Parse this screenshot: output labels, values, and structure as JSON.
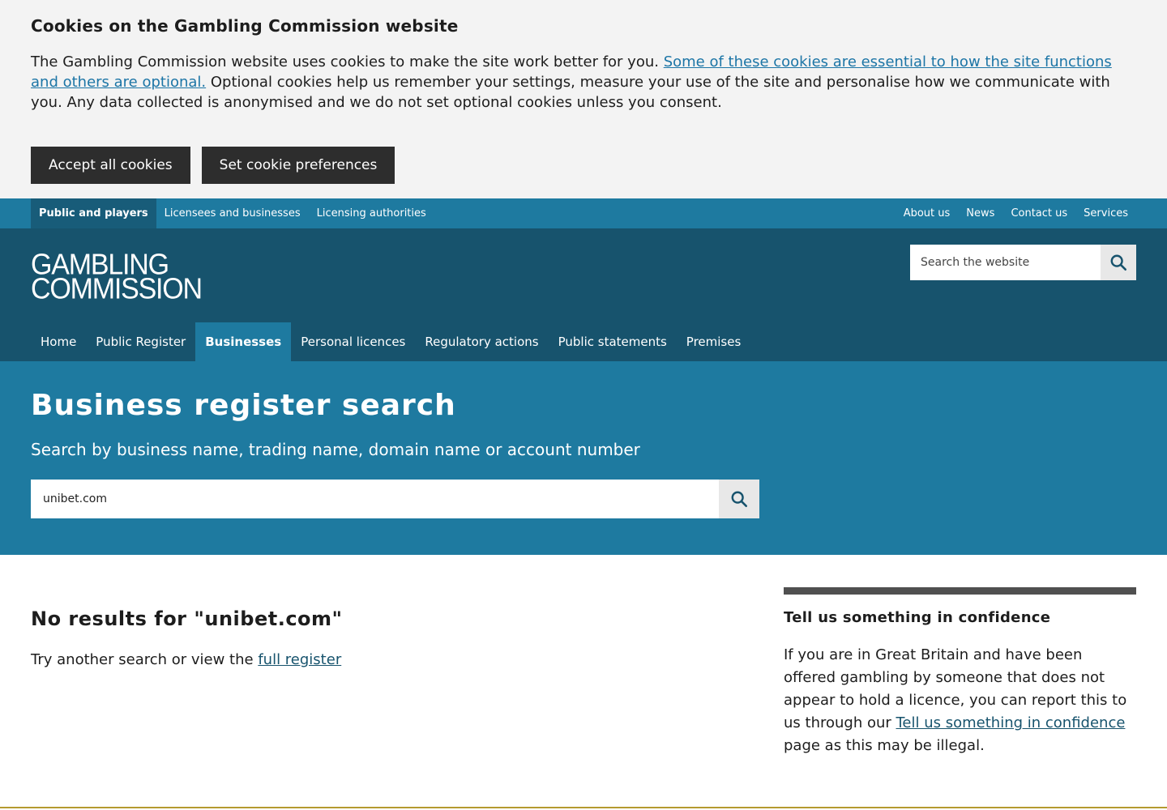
{
  "cookie": {
    "title": "Cookies on the Gambling Commission website",
    "text_before": "The Gambling Commission website uses cookies to make the site work better for you. ",
    "link_text": "Some of these cookies are essential to how the site functions and others are optional.",
    "text_after": " Optional cookies help us remember your settings, measure your use of the site and personalise how we communicate with you. Any data collected is anonymised and we do not set optional cookies unless you consent.",
    "accept_label": "Accept all cookies",
    "prefs_label": "Set cookie preferences"
  },
  "topbar": {
    "audiences": [
      {
        "label": "Public and players",
        "active": true
      },
      {
        "label": "Licensees and businesses",
        "active": false
      },
      {
        "label": "Licensing authorities",
        "active": false
      }
    ],
    "links": [
      "About us",
      "News",
      "Contact us",
      "Services"
    ]
  },
  "header": {
    "logo_line1": "GAMBLING",
    "logo_line2": "COMMISSION",
    "search_placeholder": "Search the website",
    "nav": [
      {
        "label": "Home",
        "active": false
      },
      {
        "label": "Public Register",
        "active": false
      },
      {
        "label": "Businesses",
        "active": true
      },
      {
        "label": "Personal licences",
        "active": false
      },
      {
        "label": "Regulatory actions",
        "active": false
      },
      {
        "label": "Public statements",
        "active": false
      },
      {
        "label": "Premises",
        "active": false
      }
    ]
  },
  "hero": {
    "title": "Business register search",
    "subtitle": "Search by business name, trading name, domain name or account number",
    "search_value": "unibet.com"
  },
  "results": {
    "heading": "No results for \"unibet.com\"",
    "text": "Try another search or view the ",
    "link": "full register"
  },
  "aside": {
    "title": "Tell us something in confidence",
    "text_before": "If you are in Great Britain and have been offered gambling by someone that does not appear to hold a licence, you can report this to us through our ",
    "link": "Tell us something in confidence",
    "text_after": " page as this may be illegal."
  },
  "colors": {
    "topbar": "#1e7aa0",
    "header": "#17536d",
    "hero": "#1e7aa0",
    "button_dark": "#2d2d2d"
  }
}
